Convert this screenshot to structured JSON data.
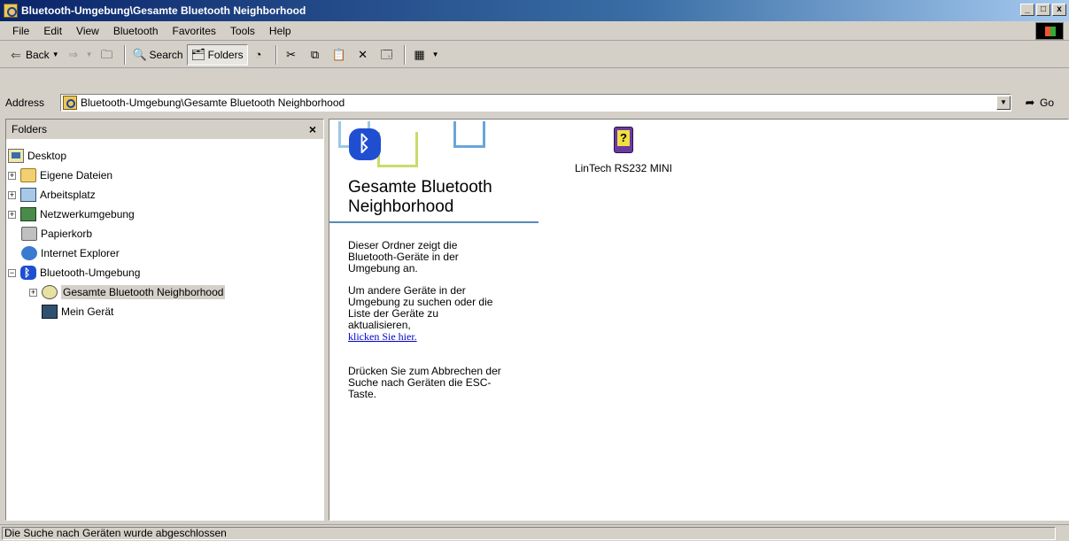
{
  "window": {
    "title": "Bluetooth-Umgebung\\Gesamte Bluetooth Neighborhood",
    "buttons": {
      "minimize": "_",
      "maximize": "□",
      "close": "x"
    }
  },
  "menu": [
    {
      "label": "File"
    },
    {
      "label": "Edit"
    },
    {
      "label": "View"
    },
    {
      "label": "Bluetooth"
    },
    {
      "label": "Favorites"
    },
    {
      "label": "Tools"
    },
    {
      "label": "Help"
    }
  ],
  "toolbar": {
    "back": "Back",
    "search": "Search",
    "folders": "Folders"
  },
  "address": {
    "label": "Address",
    "value": "Bluetooth-Umgebung\\Gesamte Bluetooth Neighborhood",
    "go": "Go"
  },
  "folders_pane": {
    "title": "Folders",
    "close": "×",
    "tree": [
      {
        "label": "Desktop",
        "icon": "desktop-icon"
      },
      {
        "label": "Eigene Dateien",
        "icon": "my-documents-icon"
      },
      {
        "label": "Arbeitsplatz",
        "icon": "my-computer-icon"
      },
      {
        "label": "Netzwerkumgebung",
        "icon": "network-icon"
      },
      {
        "label": "Papierkorb",
        "icon": "recycle-bin-icon"
      },
      {
        "label": "Internet Explorer",
        "icon": "internet-explorer-icon"
      },
      {
        "label": "Bluetooth-Umgebung",
        "icon": "bluetooth-icon"
      },
      {
        "label": "Gesamte Bluetooth Neighborhood",
        "icon": "bluetooth-neighborhood-icon",
        "selected": true
      },
      {
        "label": "Mein Gerät",
        "icon": "laptop-icon"
      }
    ]
  },
  "content": {
    "folder_title_line1": "Gesamte Bluetooth",
    "folder_title_line2": "Neighborhood",
    "info_p1_l1": "Dieser Ordner zeigt die",
    "info_p1_l2": "Bluetooth-Geräte in der",
    "info_p1_l3": "Umgebung an.",
    "info_p2_l1": "Um andere Geräte in der",
    "info_p2_l2": "Umgebung zu suchen oder die",
    "info_p2_l3": "Liste der Geräte zu",
    "info_p2_l4": "aktualisieren,",
    "info_link": "klicken Sie hier.",
    "info_p3_l1": "Drücken Sie zum Abbrechen der",
    "info_p3_l2": "Suche nach Geräten die ESC-",
    "info_p3_l3": "Taste.",
    "device_label": "LinTech RS232 MINI"
  },
  "status": {
    "text": "Die Suche nach Geräten wurde abgeschlossen"
  }
}
